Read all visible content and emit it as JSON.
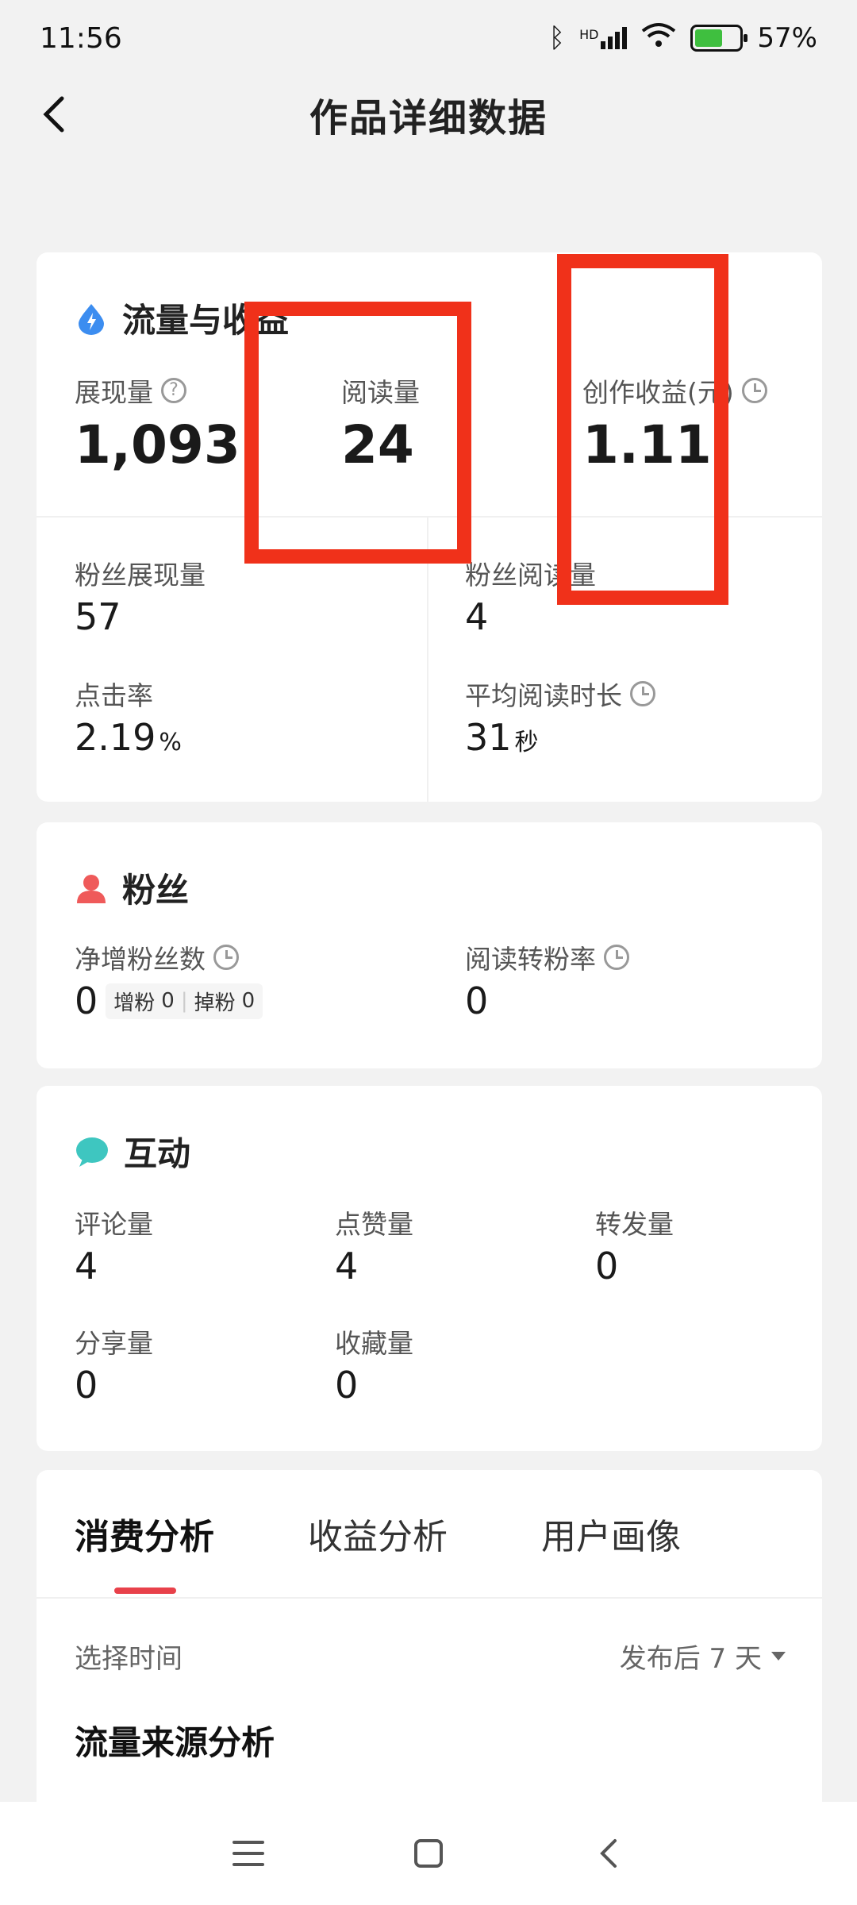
{
  "status": {
    "time": "11:56",
    "signal_tag": "HD",
    "battery": "57%"
  },
  "nav": {
    "title": "作品详细数据"
  },
  "traffic": {
    "title": "流量与收益",
    "impressions_label": "展现量",
    "impressions": "1,093",
    "reads_label": "阅读量",
    "reads": "24",
    "earnings_label": "创作收益(元)",
    "earnings": "1.11",
    "fan_impressions_label": "粉丝展现量",
    "fan_impressions": "57",
    "fan_reads_label": "粉丝阅读量",
    "fan_reads": "4",
    "ctr_label": "点击率",
    "ctr": "2.19",
    "ctr_unit": "%",
    "avg_time_label": "平均阅读时长",
    "avg_time": "31",
    "avg_time_unit": "秒"
  },
  "fans": {
    "title": "粉丝",
    "net_label": "净增粉丝数",
    "net": "0",
    "gain_label": "增粉",
    "gain": "0",
    "loss_label": "掉粉",
    "loss": "0",
    "conv_label": "阅读转粉率",
    "conv": "0"
  },
  "interaction": {
    "title": "互动",
    "comments_label": "评论量",
    "comments": "4",
    "likes_label": "点赞量",
    "likes": "4",
    "reposts_label": "转发量",
    "reposts": "0",
    "shares_label": "分享量",
    "shares": "0",
    "favorites_label": "收藏量",
    "favorites": "0"
  },
  "analysis": {
    "tabs": [
      "消费分析",
      "收益分析",
      "用户画像"
    ],
    "time_label": "选择时间",
    "time_value": "发布后 7 天",
    "section_title": "流量来源分析"
  },
  "colors": {
    "accent_red": "#f0311a",
    "tab_indicator": "#e8414a"
  }
}
